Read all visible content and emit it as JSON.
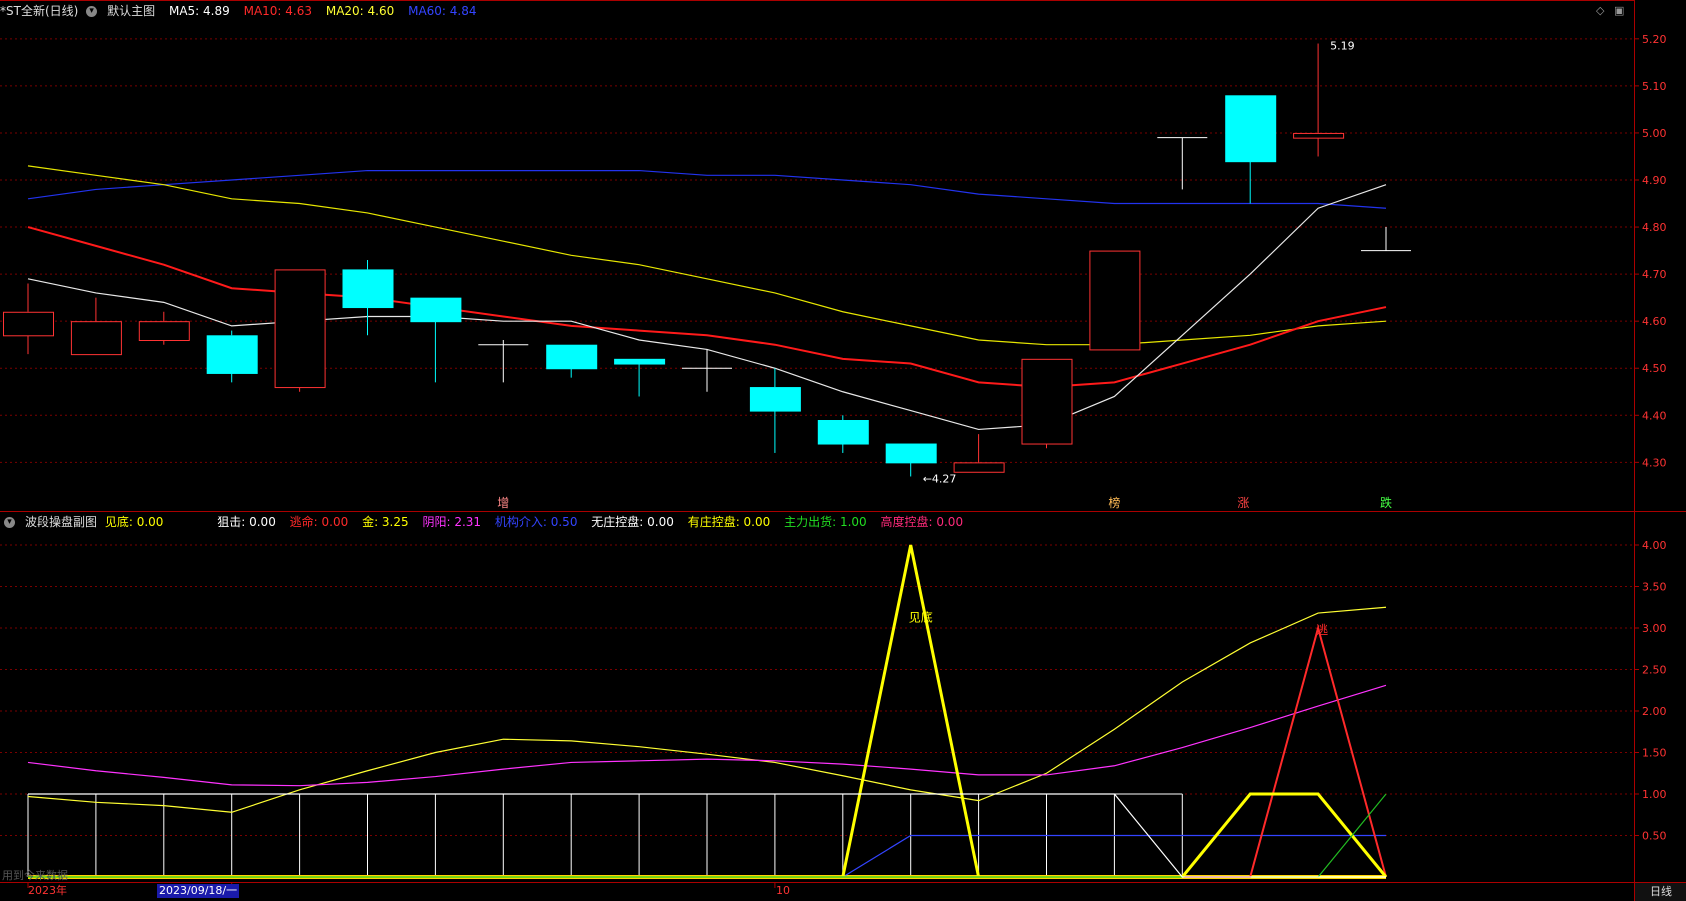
{
  "header": {
    "title": "*ST全新(日线)",
    "main_chart": "默认主图",
    "ma": [
      {
        "label": "MA5: 4.89",
        "color": "#ffffff"
      },
      {
        "label": "MA10: 4.63",
        "color": "#ff2a2a"
      },
      {
        "label": "MA20: 4.60",
        "color": "#ffff33"
      },
      {
        "label": "MA60: 4.84",
        "color": "#3344ff"
      }
    ]
  },
  "sub_header": {
    "title": "波段操盘副图",
    "items": [
      {
        "label": "见底: 0.00",
        "color": "#ffff00"
      },
      {
        "label": "狙击: 0.00",
        "color": "#ffffff",
        "gap": true
      },
      {
        "label": "逃命: 0.00",
        "color": "#ff2a2a"
      },
      {
        "label": "金: 3.25",
        "color": "#ffff00"
      },
      {
        "label": "阴阳: 2.31",
        "color": "#ff33ff"
      },
      {
        "label": "机构介入: 0.50",
        "color": "#3344ff"
      },
      {
        "label": "无庄控盘: 0.00",
        "color": "#ffffff"
      },
      {
        "label": "有庄控盘: 0.00",
        "color": "#ffff00"
      },
      {
        "label": "主力出货: 1.00",
        "color": "#22dd22"
      },
      {
        "label": "高度控盘: 0.00",
        "color": "#ff2a7a"
      }
    ]
  },
  "chart_data": [
    {
      "type": "candlestick",
      "ylim": [
        4.22,
        5.24
      ],
      "y_ticks": [
        "5.20",
        "5.10",
        "5.00",
        "4.90",
        "4.80",
        "4.70",
        "4.60",
        "4.50",
        "4.40",
        "4.30"
      ],
      "candles": [
        {
          "o": 4.57,
          "h": 4.68,
          "l": 4.53,
          "c": 4.62
        },
        {
          "o": 4.53,
          "h": 4.65,
          "l": 4.53,
          "c": 4.6
        },
        {
          "o": 4.56,
          "h": 4.62,
          "l": 4.55,
          "c": 4.6
        },
        {
          "o": 4.57,
          "h": 4.58,
          "l": 4.47,
          "c": 4.49
        },
        {
          "o": 4.46,
          "h": 4.71,
          "l": 4.45,
          "c": 4.71
        },
        {
          "o": 4.71,
          "h": 4.73,
          "l": 4.57,
          "c": 4.63
        },
        {
          "o": 4.65,
          "h": 4.65,
          "l": 4.47,
          "c": 4.6
        },
        {
          "o": 4.55,
          "h": 4.56,
          "l": 4.47,
          "c": 4.55
        },
        {
          "o": 4.55,
          "h": 4.55,
          "l": 4.48,
          "c": 4.5
        },
        {
          "o": 4.52,
          "h": 4.52,
          "l": 4.44,
          "c": 4.51
        },
        {
          "o": 4.5,
          "h": 4.54,
          "l": 4.45,
          "c": 4.5
        },
        {
          "o": 4.46,
          "h": 4.5,
          "l": 4.32,
          "c": 4.41
        },
        {
          "o": 4.39,
          "h": 4.4,
          "l": 4.32,
          "c": 4.34
        },
        {
          "o": 4.34,
          "h": 4.34,
          "l": 4.27,
          "c": 4.3
        },
        {
          "o": 4.28,
          "h": 4.36,
          "l": 4.28,
          "c": 4.3
        },
        {
          "o": 4.34,
          "h": 4.52,
          "l": 4.33,
          "c": 4.52
        },
        {
          "o": 4.54,
          "h": 4.75,
          "l": 4.54,
          "c": 4.75
        },
        {
          "o": 4.99,
          "h": 4.99,
          "l": 4.88,
          "c": 4.99
        },
        {
          "o": 5.08,
          "h": 5.08,
          "l": 4.85,
          "c": 4.94
        },
        {
          "o": 4.99,
          "h": 5.19,
          "l": 4.95,
          "c": 5.0
        },
        {
          "o": 4.75,
          "h": 4.8,
          "l": 4.75,
          "c": 4.75
        }
      ],
      "ma5": [
        4.69,
        4.66,
        4.64,
        4.59,
        4.6,
        4.61,
        4.61,
        4.6,
        4.6,
        4.56,
        4.54,
        4.5,
        4.45,
        4.41,
        4.37,
        4.38,
        4.44,
        4.57,
        4.7,
        4.84,
        4.89
      ],
      "ma10": [
        4.8,
        4.76,
        4.72,
        4.67,
        4.66,
        4.65,
        4.63,
        4.61,
        4.59,
        4.58,
        4.57,
        4.55,
        4.52,
        4.51,
        4.47,
        4.46,
        4.47,
        4.51,
        4.55,
        4.6,
        4.63
      ],
      "ma20": [
        4.93,
        4.91,
        4.89,
        4.86,
        4.85,
        4.83,
        4.8,
        4.77,
        4.74,
        4.72,
        4.69,
        4.66,
        4.62,
        4.59,
        4.56,
        4.55,
        4.55,
        4.56,
        4.57,
        4.59,
        4.6
      ],
      "ma60": [
        4.86,
        4.88,
        4.89,
        4.9,
        4.91,
        4.92,
        4.92,
        4.92,
        4.92,
        4.92,
        4.91,
        4.91,
        4.9,
        4.89,
        4.87,
        4.86,
        4.85,
        4.85,
        4.85,
        4.85,
        4.84
      ],
      "annotations": [
        {
          "text": "←4.27",
          "i": 13,
          "v": 4.27,
          "color": "#ffffff"
        },
        {
          "text": "5.19",
          "i": 19,
          "v": 5.19,
          "color": "#ffffff"
        }
      ],
      "signals": [
        {
          "text": "增",
          "i": 7,
          "color": "#ff8888"
        },
        {
          "text": "榜",
          "i": 16,
          "color": "#ffbb55"
        },
        {
          "text": "涨",
          "i": 17.9,
          "color": "#ff4444"
        },
        {
          "text": "跌",
          "i": 20,
          "color": "#44ff44"
        }
      ]
    },
    {
      "type": "line",
      "ylim": [
        0,
        4.0
      ],
      "y_ticks": [
        "4.00",
        "3.50",
        "3.00",
        "2.50",
        "2.00",
        "1.50",
        "1.00",
        "0.50"
      ],
      "series": [
        {
          "name": "金",
          "color": "#ffff33",
          "values": [
            0.97,
            0.9,
            0.86,
            0.78,
            1.05,
            1.28,
            1.5,
            1.66,
            1.64,
            1.57,
            1.48,
            1.38,
            1.22,
            1.05,
            0.92,
            1.25,
            1.78,
            2.35,
            2.82,
            3.18,
            3.25
          ]
        },
        {
          "name": "阴阳",
          "color": "#ff33ff",
          "values": [
            1.38,
            1.28,
            1.2,
            1.11,
            1.1,
            1.14,
            1.21,
            1.3,
            1.38,
            1.4,
            1.42,
            1.4,
            1.36,
            1.3,
            1.23,
            1.23,
            1.34,
            1.56,
            1.8,
            2.06,
            2.31
          ]
        },
        {
          "name": "机构介入",
          "color": "#3344ff",
          "values": [
            0,
            0,
            0,
            0,
            0,
            0,
            0,
            0,
            0,
            0,
            0,
            0,
            0,
            0.5,
            0.5,
            0.5,
            0.5,
            0.5,
            0.5,
            0.5,
            0.5
          ]
        },
        {
          "name": "见底",
          "color": "#ffff00",
          "width": 3,
          "values": [
            0,
            0,
            0,
            0,
            0,
            0,
            0,
            0,
            0,
            0,
            0,
            0,
            0,
            4.0,
            0,
            0,
            0,
            0,
            0,
            0,
            0
          ]
        },
        {
          "name": "逃命",
          "color": "#ff2a2a",
          "width": 2,
          "values": [
            0,
            0,
            0,
            0,
            0,
            0,
            0,
            0,
            0,
            0,
            0,
            0,
            0,
            0,
            0,
            0,
            0,
            0,
            0,
            3.0,
            0
          ]
        },
        {
          "name": "有庄控盘",
          "color": "#ffff00",
          "width": 3,
          "values": [
            0,
            0,
            0,
            0,
            0,
            0,
            0,
            0,
            0,
            0,
            0,
            0,
            0,
            0,
            0,
            0,
            0,
            0,
            1.0,
            1.0,
            0
          ]
        },
        {
          "name": "主力出货",
          "color": "#22bb22",
          "values": [
            0,
            0,
            0,
            0,
            0,
            0,
            0,
            0,
            0,
            0,
            0,
            0,
            0,
            0,
            0,
            0,
            0,
            0,
            0,
            0,
            1.0
          ]
        },
        {
          "name": "无庄控盘",
          "color": "#ffffff",
          "values": [
            1,
            1,
            1,
            1,
            1,
            1,
            1,
            1,
            1,
            1,
            1,
            1,
            1,
            1,
            1,
            1,
            1,
            0,
            0,
            0,
            0
          ]
        }
      ],
      "bars_white_until": 17,
      "labels": [
        {
          "text": "见底",
          "i": 13,
          "v": 3.15,
          "color": "#ffff00"
        },
        {
          "text": "逃",
          "i": 19,
          "v": 3.0,
          "color": "#ff2a2a"
        }
      ]
    }
  ],
  "xaxis": {
    "year": "2023年",
    "date_highlight": "2023/09/18/一",
    "month": "10"
  },
  "period": "日线",
  "ghost_text": "用到今来数据"
}
